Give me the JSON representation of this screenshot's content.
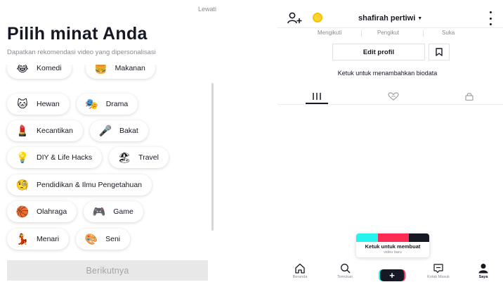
{
  "interests_screen": {
    "skip_label": "Lewati",
    "title": "Pilih minat Anda",
    "subtitle": "Dapatkan rekomendasi video yang dipersonalisasi",
    "rows": [
      [
        {
          "emoji": "😂",
          "label": "Komedi"
        },
        {
          "emoji": "🍔",
          "label": "Makanan"
        }
      ],
      [
        {
          "emoji": "🐱",
          "label": "Hewan"
        },
        {
          "emoji": "🎭",
          "label": "Drama"
        }
      ],
      [
        {
          "emoji": "💄",
          "label": "Kecantikan"
        },
        {
          "emoji": "🎤",
          "label": "Bakat"
        }
      ],
      [
        {
          "emoji": "💡",
          "label": "DIY & Life Hacks"
        },
        {
          "emoji": "🏖",
          "label": "Travel"
        }
      ],
      [
        {
          "emoji": "🧐",
          "label": "Pendidikan & Ilmu Pengetahuan"
        }
      ],
      [
        {
          "emoji": "🏀",
          "label": "Olahraga"
        },
        {
          "emoji": "🎮",
          "label": "Game"
        }
      ],
      [
        {
          "emoji": "💃",
          "label": "Menari"
        },
        {
          "emoji": "🎨",
          "label": "Seni"
        }
      ]
    ],
    "next_button_label": "Berikutnya"
  },
  "profile_screen": {
    "username": "shafirah pertiwi",
    "stats": {
      "following_label": "Mengikuti",
      "followers_label": "Pengikut",
      "likes_label": "Suka"
    },
    "edit_profile_label": "Edit profil",
    "bio_prompt": "Ketuk untuk menambahkan biodata",
    "create_card": {
      "title": "Ketuk untuk membuat",
      "subtitle": "video baru"
    },
    "bottom_nav": {
      "home": "Beranda",
      "discover": "Temukan",
      "inbox": "Kotak Masuk",
      "me": "Saya"
    },
    "icons": [
      "add-user-icon",
      "coin-icon",
      "more-icon",
      "bookmark-icon",
      "grid-icon",
      "liked-icon",
      "lock-icon",
      "home-icon",
      "search-icon",
      "plus-icon",
      "inbox-icon",
      "profile-icon"
    ],
    "colors": {
      "accent_cyan": "#25f4ee",
      "accent_red": "#fe2c55",
      "text": "#161823"
    }
  }
}
